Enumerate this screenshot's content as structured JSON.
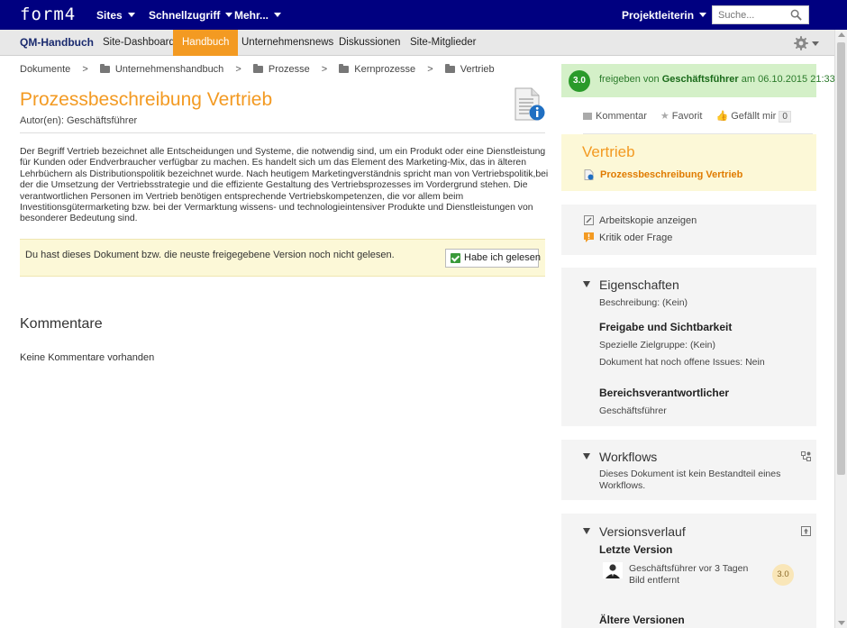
{
  "app": {
    "logo": "form4",
    "nav": [
      {
        "label": "Sites"
      },
      {
        "label": "Schnellzugriff"
      },
      {
        "label": "Mehr..."
      }
    ],
    "user_menu": "Projektleiterin",
    "search_placeholder": "Suche..."
  },
  "site": {
    "title": "QM-Handbuch",
    "tabs": [
      {
        "label": "Site-Dashboard"
      },
      {
        "label": "Handbuch",
        "active": true
      },
      {
        "label": "Unternehmensnews"
      },
      {
        "label": "Diskussionen"
      },
      {
        "label": "Site-Mitglieder"
      }
    ]
  },
  "breadcrumb": {
    "root": "Dokumente",
    "folders": [
      "Unternehmenshandbuch",
      "Prozesse",
      "Kernprozesse",
      "Vertrieb"
    ]
  },
  "document": {
    "title": "Prozessbeschreibung Vertrieb",
    "author": "Autor(en): Geschäftsführer",
    "body": "Der Begriff Vertrieb bezeichnet alle Entscheidungen und Systeme, die notwendig sind, um ein Produkt oder eine Dienstleistung für Kunden oder Endverbraucher verfügbar zu machen. Es handelt sich um das Element des Marketing-Mix, das in älteren Lehrbüchern als Distributionspolitik bezeichnet wurde. Nach heutigem Marketingverständnis spricht man von Vertriebspolitik,bei der die Umsetzung der Vertriebsstrategie und die effiziente Gestaltung des Vertriebsprozesses im Vordergrund stehen. Die verantwortlichen Personen im Vertrieb benötigen entsprechende Vertriebskompetenzen, die vor allem beim Investitionsgütermarketing bzw. bei der Vermarktung wissens- und technologieintensiver Produkte und Dienstleistungen von besonderer Bedeutung sind.",
    "read_notice": "Du hast dieses Dokument bzw. die neuste freigegebene Version noch nicht gelesen.",
    "read_button": "Habe ich gelesen",
    "comments_heading": "Kommentare",
    "no_comments": "Keine Kommentare vorhanden"
  },
  "status": {
    "version": "3.0",
    "text_prefix": "freigeben von",
    "by": "Geschäftsführer",
    "text_suffix": "am 06.10.2015 21:33"
  },
  "social": {
    "comment": "Kommentar",
    "favorite": "Favorit",
    "like": "Gefällt mir",
    "like_count": "0"
  },
  "category_panel": {
    "title": "Vertrieb",
    "link": "Prozessbeschreibung Vertrieb"
  },
  "doc_actions": {
    "working_copy": "Arbeitskopie anzeigen",
    "critique": "Kritik oder Frage"
  },
  "properties": {
    "title": "Eigenschaften",
    "description": "Beschreibung:   (Kein)",
    "release_heading": "Freigabe und Sichtbarkeit",
    "target_group": "Spezielle Zielgruppe:   (Kein)",
    "open_issues": "Dokument hat noch offene Issues:   Nein",
    "responsible_heading": "Bereichsverantwortlicher",
    "responsible": "Geschäftsführer"
  },
  "workflows": {
    "title": "Workflows",
    "text": "Dieses Dokument ist kein Bestandteil eines Workflows."
  },
  "versions": {
    "title": "Versionsverlauf",
    "latest_heading": "Letzte Version",
    "latest_author": "Geschäftsführer vor 3 Tagen",
    "latest_note": "Bild entfernt",
    "latest_version": "3.0",
    "older_heading": "Ältere Versionen"
  },
  "colors": {
    "header_bg": "#000080",
    "accent": "#f39a22",
    "status_green": "#2a9a2a",
    "notice_yellow": "#fcf8d7"
  }
}
